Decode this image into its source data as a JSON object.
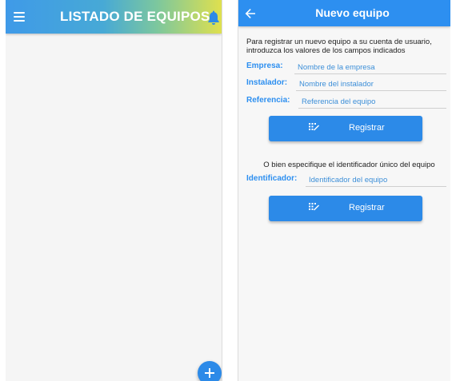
{
  "left_screen": {
    "title": "LISTADO DE EQUIPOS",
    "icons": {
      "menu": "menu-icon",
      "notifications": "bell-icon",
      "add": "plus-icon"
    }
  },
  "right_screen": {
    "title": "Nuevo equipo",
    "intro": "Para registrar un nuevo equipo a su cuenta de usuario, introduzca los valores de los campos indicados",
    "fields": [
      {
        "label": "Empresa:",
        "placeholder": "Nombre de la empresa",
        "value": ""
      },
      {
        "label": "Instalador:",
        "placeholder": "Nombre del instalador",
        "value": ""
      },
      {
        "label": "Referencia:",
        "placeholder": "Referencia del equipo",
        "value": ""
      }
    ],
    "register_button_1": "Registrar",
    "alternative_text": "O bien especifique el identificador único del equipo",
    "identifier_field": {
      "label": "Identificador:",
      "placeholder": "Identificador del equipo",
      "value": ""
    },
    "register_button_2": "Registrar",
    "icons": {
      "back": "back-arrow-icon",
      "register": "dialpad-icon"
    }
  },
  "colors": {
    "primary": "#2d8ff0",
    "gradient_start": "#3f9ae8",
    "gradient_end": "#dfe04e",
    "notification": "#2c8ae8"
  }
}
